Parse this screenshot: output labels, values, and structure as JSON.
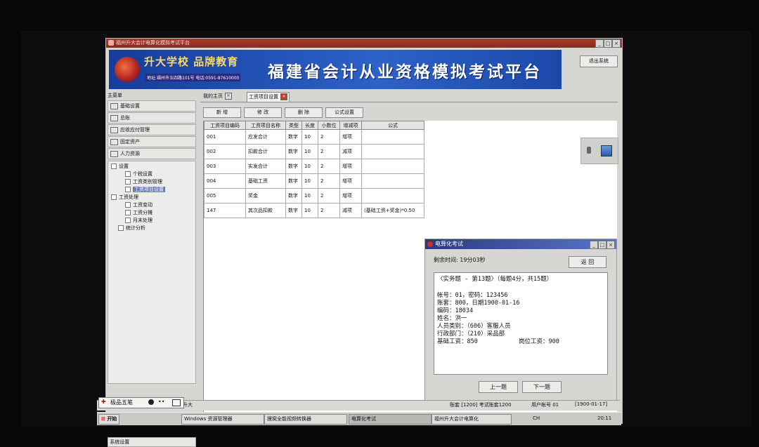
{
  "window": {
    "title": "福州升大会计电算化模拟考试平台"
  },
  "banner": {
    "slogan": "升大学校 品牌教育",
    "address": "地址:福州市五四路101号 电话:0591-87610000",
    "platform_title": "福建省会计从业资格模拟考试平台",
    "exit_label": "退出系统"
  },
  "menu": {
    "header": "主菜单",
    "modules": [
      "基础设置",
      "总账",
      "应收应付管理",
      "固定资产",
      "人力资源"
    ],
    "tree": [
      {
        "label": "设置",
        "level": 1
      },
      {
        "label": "个税设置",
        "level": 2
      },
      {
        "label": "工资类别管理",
        "level": 2
      },
      {
        "label": "工资项目设置",
        "level": 2,
        "selected": true
      },
      {
        "label": "工资处理",
        "level": 1
      },
      {
        "label": "工资变动",
        "level": 2
      },
      {
        "label": "工资分摊",
        "level": 2
      },
      {
        "label": "月末处理",
        "level": 2
      },
      {
        "label": "统计分析",
        "level": 1
      }
    ],
    "system_settings": "系统设置"
  },
  "tabs": [
    {
      "label": "我的主页",
      "active": false
    },
    {
      "label": "工资项目设置",
      "active": true
    }
  ],
  "toolbar": {
    "add": "新 增",
    "edit": "修 改",
    "delete": "删 除",
    "formula": "公式设置"
  },
  "table": {
    "headers": [
      "工资项目编码",
      "工资项目名称",
      "类型",
      "长度",
      "小数位",
      "增减项",
      "公式"
    ],
    "rows": [
      [
        "001",
        "应发合计",
        "数字",
        "10",
        "2",
        "增项",
        ""
      ],
      [
        "002",
        "扣款合计",
        "数字",
        "10",
        "2",
        "减项",
        ""
      ],
      [
        "003",
        "实发合计",
        "数字",
        "10",
        "2",
        "增项",
        ""
      ],
      [
        "004",
        "基础工资",
        "数字",
        "10",
        "2",
        "增项",
        ""
      ],
      [
        "005",
        "奖金",
        "数字",
        "10",
        "2",
        "增项",
        ""
      ],
      [
        "147",
        "其次品扣款",
        "数字",
        "10",
        "2",
        "减项",
        "(基础工资+奖金)*0.50"
      ]
    ]
  },
  "dialog": {
    "title": "电算化考试",
    "remaining": "剩余时间: 19分03秒",
    "back_label": "返 回",
    "question_header": "〈实务题 - 第13题〉（每题4分，共15题）",
    "lines": [
      "帐号：01，密码：123456",
      "账套：800，日期1900-01-16",
      "编码：18034",
      "姓名：洪一",
      "人员类别：（606）客服人员",
      "行政部门：（210）采品部",
      "基础工资：850"
    ],
    "extra": "岗位工资：900",
    "prev_label": "上一题",
    "next_label": "下一题"
  },
  "ime": {
    "name": "极品五笔"
  },
  "status": {
    "company": "福州升大",
    "account": "账套 [1200] 考试账套1200",
    "user": "用户帐号 01",
    "date": "[1900-01-17]"
  },
  "taskbar": {
    "start": "开始",
    "items": [
      {
        "label": "Windows 资源管理器",
        "active": false
      },
      {
        "label": "狸窝全能视频转换器",
        "active": false
      },
      {
        "label": "电算化考试",
        "active": true
      },
      {
        "label": "福州升大会计电算化",
        "active": false
      }
    ],
    "tray": "CH",
    "clock": "20:11"
  }
}
